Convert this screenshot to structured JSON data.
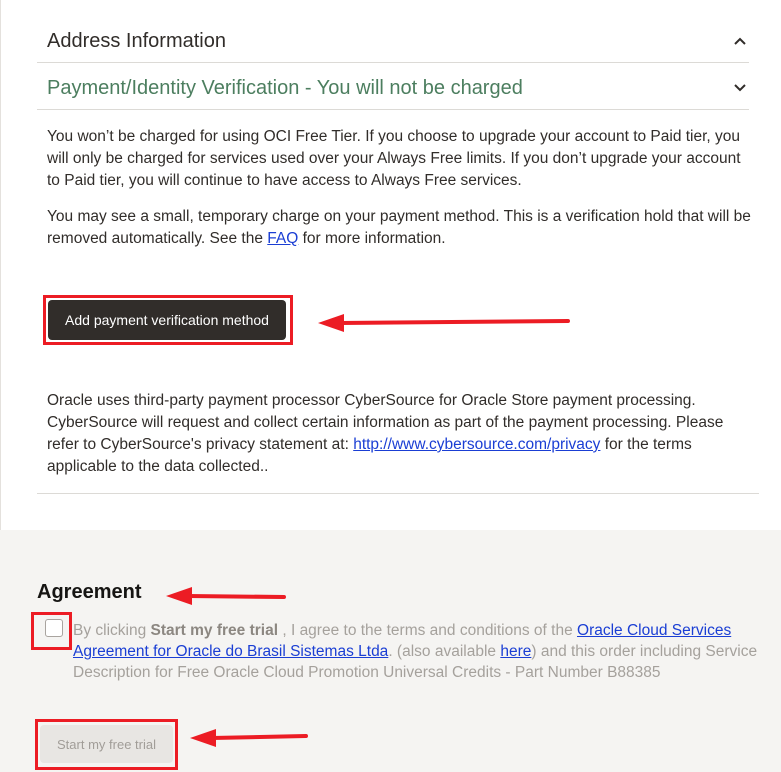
{
  "address_section": {
    "title": "Address Information"
  },
  "payment_section": {
    "title": "Payment/Identity Verification - You will not be charged",
    "paragraph1": "You won’t be charged for using OCI Free Tier. If you choose to upgrade your account to Paid tier, you will only be charged for services used over your Always Free limits. If you don’t upgrade your account to Paid tier, you will continue to have access to Always Free services.",
    "paragraph2_before": "You may see a small, temporary charge on your payment method. This is a verification hold that will be removed automatically. See the ",
    "faq_link": "FAQ",
    "paragraph2_after": " for more information.",
    "add_button": "Add payment verification method",
    "processor_before": "Oracle uses third-party payment processor CyberSource for Oracle Store payment processing. CyberSource will request and collect certain information as part of the payment processing. Please refer to CyberSource's privacy statement at: ",
    "privacy_link": "http://www.cybersource.com/privacy",
    "processor_after": " for the terms applicable to the data collected.."
  },
  "agreement": {
    "heading": "Agreement",
    "text_prefix": "By clicking ",
    "text_bold": "Start my free trial",
    "text_mid": " , I agree to the terms and conditions of the ",
    "link_agreement": "Oracle Cloud Services Agreement for Oracle do Brasil Sistemas Ltda",
    "text_mid2": ". (also available ",
    "link_here": "here",
    "text_suffix": ") and this order including Service Description for Free Oracle Cloud Promotion Universal Credits - Part Number B88385",
    "checkbox_checked": false,
    "start_button": "Start my free trial"
  },
  "icons": {
    "address_chevron": "chevron-up-icon",
    "payment_chevron": "chevron-down-icon"
  },
  "colors": {
    "annotation_red": "#ec1c24",
    "payment_title_green": "#4c7e5f",
    "link_blue": "#1a3ed4",
    "dark_button": "#312d2a",
    "agreement_panel_bg": "#f5f4f2"
  }
}
